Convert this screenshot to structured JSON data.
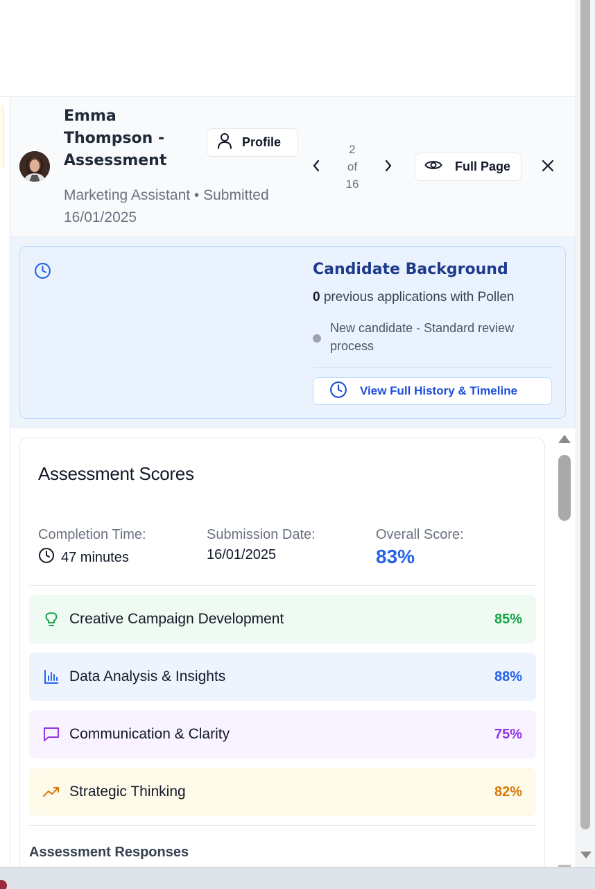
{
  "header": {
    "candidate_name": "Emma Thompson - Assessment",
    "subtitle": "Marketing Assistant • Submitted 16/01/2025",
    "profile_label": "Profile",
    "pager": {
      "current": "2",
      "of": "of",
      "total": "16"
    },
    "full_page_label": "Full Page"
  },
  "background": {
    "title": "Candidate Background",
    "previous_count": "0",
    "previous_text": "previous applications with Pollen",
    "note": "New candidate - Standard review process",
    "history_button": "View Full History & Timeline"
  },
  "scores": {
    "title": "Assessment Scores",
    "completion_label": "Completion Time:",
    "completion_value": "47 minutes",
    "submission_label": "Submission Date:",
    "submission_value": "16/01/2025",
    "overall_label": "Overall Score:",
    "overall_value": "83%",
    "items": [
      {
        "name": "Creative Campaign Development",
        "percent": "85%",
        "icon": "lightbulb-icon",
        "color": "#16a34a",
        "bg": "#effaf2"
      },
      {
        "name": "Data Analysis & Insights",
        "percent": "88%",
        "icon": "bar-chart-icon",
        "color": "#2563eb",
        "bg": "#eef4fe"
      },
      {
        "name": "Communication & Clarity",
        "percent": "75%",
        "icon": "message-square-icon",
        "color": "#9333ea",
        "bg": "#f8f3fe"
      },
      {
        "name": "Strategic Thinking",
        "percent": "82%",
        "icon": "trending-up-icon",
        "color": "#d97706",
        "bg": "#fefaea"
      }
    ],
    "responses_title": "Assessment Responses"
  },
  "colors": {
    "accent_blue": "#2563eb",
    "header_bg": "#f8fafc",
    "background_card": "#eaf2fd"
  }
}
